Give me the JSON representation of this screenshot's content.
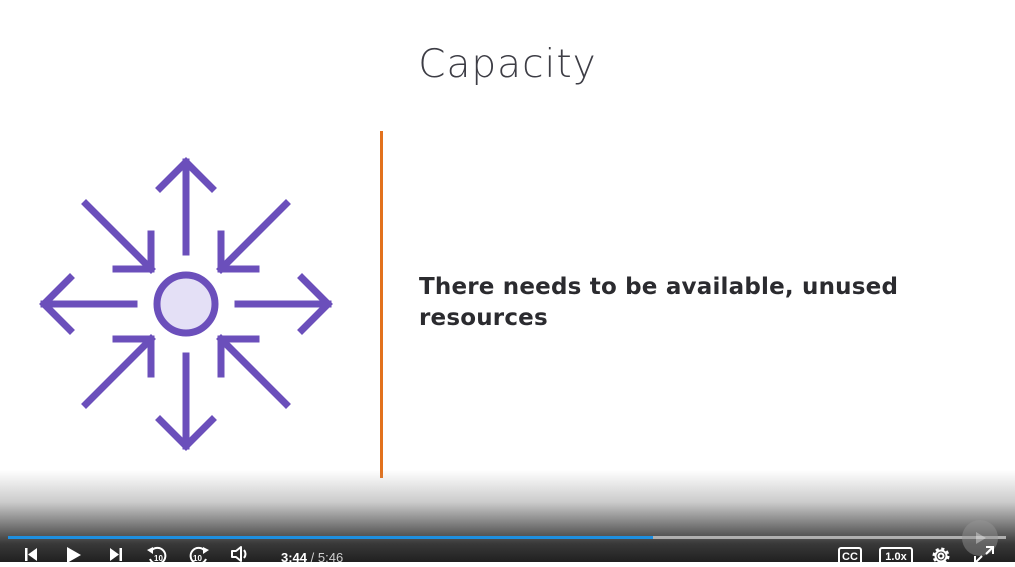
{
  "slide": {
    "title": "Capacity",
    "body_text": "There needs to be available, unused resources",
    "accent_color": "#6b4fbb",
    "divider_color": "#e2711d"
  },
  "player": {
    "current_time": "3:44",
    "time_separator": "/",
    "duration": "5:46",
    "progress_fraction": 0.646,
    "progress_color": "#1e8fe0",
    "skip_back_seconds": "10",
    "skip_forward_seconds": "10",
    "captions_label": "CC",
    "speed_label": "1.0x",
    "icons": [
      "previous-icon",
      "play-icon",
      "next-icon",
      "rewind-10-icon",
      "forward-10-icon",
      "volume-icon",
      "captions-icon",
      "speed-icon",
      "settings-icon",
      "fullscreen-icon"
    ]
  }
}
